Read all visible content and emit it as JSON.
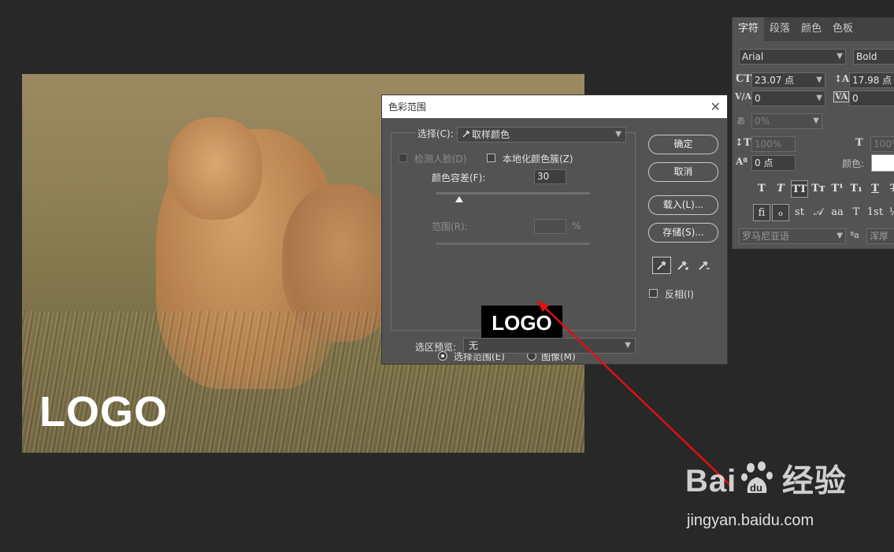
{
  "photo": {
    "logo_text": "LOGO"
  },
  "dialog": {
    "title": "色彩范围",
    "close_glyph": "✕",
    "select_label": "选择(C):",
    "select_value": "取样颜色",
    "detect_faces_label": "检测人脸(D)",
    "localized_clusters_label": "本地化颜色簇(Z)",
    "fuzziness_label": "颜色容差(F):",
    "fuzziness_value": "30",
    "fuzziness_level": 0.15,
    "range_label": "范围(R):",
    "range_unit": "%",
    "preview_text": "LOGO",
    "radio_selection_label": "选择范围(E)",
    "radio_image_label": "图像(M)",
    "selection_preview_label": "选区预览:",
    "selection_preview_value": "无",
    "ok_label": "确定",
    "cancel_label": "取消",
    "load_label": "载入(L)...",
    "save_label": "存储(S)...",
    "invert_label": "反相(I)"
  },
  "panel": {
    "tabs": [
      "字符",
      "段落",
      "颜色",
      "色板"
    ],
    "font_family": "Arial",
    "font_style": "Bold",
    "font_size": "23.07 点",
    "leading": "17.98 点",
    "kerning": "0",
    "tracking": "0",
    "tsume": "0%",
    "vertical_scale": "100%",
    "horizontal_scale": "100%",
    "baseline_shift": "0 点",
    "color_label": "颜色:",
    "color_swatch": "#ffffff",
    "language": "罗马尼亚语",
    "antialias": "浑厚",
    "type_buttons": [
      "T",
      "T",
      "TT",
      "Tт",
      "T¹",
      "T₁",
      "T",
      "T"
    ],
    "opentype_buttons": [
      "fi",
      "ℴ",
      "st",
      "𝒜",
      "aa",
      "T",
      "1st",
      "½"
    ]
  },
  "watermark": {
    "brand": "Bai",
    "brand_suffix": "经验",
    "url": "jingyan.baidu.com"
  },
  "colors": {
    "bg": "#282828",
    "dialog_bg": "#535353",
    "arrow": "#e01010"
  }
}
